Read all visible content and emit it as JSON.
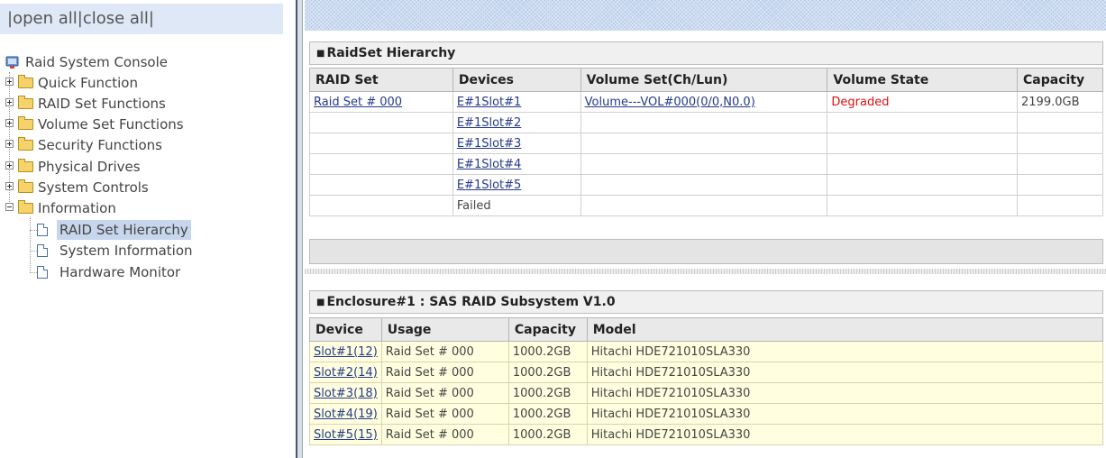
{
  "tree_panel": {
    "toggle": {
      "open_all": "|open all",
      "close_all": "|close all|"
    },
    "root": "Raid System Console",
    "folders": [
      "Quick Function",
      "RAID Set Functions",
      "Volume Set Functions",
      "Security Functions",
      "Physical Drives",
      "System Controls",
      "Information"
    ],
    "info_items": [
      "RAID Set Hierarchy",
      "System Information",
      "Hardware Monitor"
    ],
    "selected": "RAID Set Hierarchy"
  },
  "raidset": {
    "title": "RaidSet Hierarchy",
    "headers": [
      "RAID Set",
      "Devices",
      "Volume Set(Ch/Lun)",
      "Volume State",
      "Capacity"
    ],
    "rows": [
      [
        "Raid Set # 000",
        "E#1Slot#1",
        "Volume---VOL#000(0/0,N0.0)",
        "Degraded",
        "2199.0GB"
      ],
      [
        "",
        "E#1Slot#2",
        "",
        "",
        ""
      ],
      [
        "",
        "E#1Slot#3",
        "",
        "",
        ""
      ],
      [
        "",
        "E#1Slot#4",
        "",
        "",
        ""
      ],
      [
        "",
        "E#1Slot#5",
        "",
        "",
        ""
      ],
      [
        "",
        "Failed",
        "",
        "",
        ""
      ]
    ]
  },
  "enclosure": {
    "title": "Enclosure#1 : SAS RAID Subsystem V1.0",
    "headers": [
      "Device",
      "Usage",
      "Capacity",
      "Model"
    ],
    "rows": [
      [
        "Slot#1(12)",
        "Raid Set # 000",
        "1000.2GB",
        "Hitachi HDE721010SLA330"
      ],
      [
        "Slot#2(14)",
        "Raid Set # 000",
        "1000.2GB",
        "Hitachi HDE721010SLA330"
      ],
      [
        "Slot#3(18)",
        "Raid Set # 000",
        "1000.2GB",
        "Hitachi HDE721010SLA330"
      ],
      [
        "Slot#4(19)",
        "Raid Set # 000",
        "1000.2GB",
        "Hitachi HDE721010SLA330"
      ],
      [
        "Slot#5(15)",
        "Raid Set # 000",
        "1000.2GB",
        "Hitachi HDE721010SLA330"
      ]
    ]
  },
  "colors": {
    "degraded": "#e01010",
    "link": "#243a8a",
    "enclosure_row_bg": "#ffffe0"
  }
}
